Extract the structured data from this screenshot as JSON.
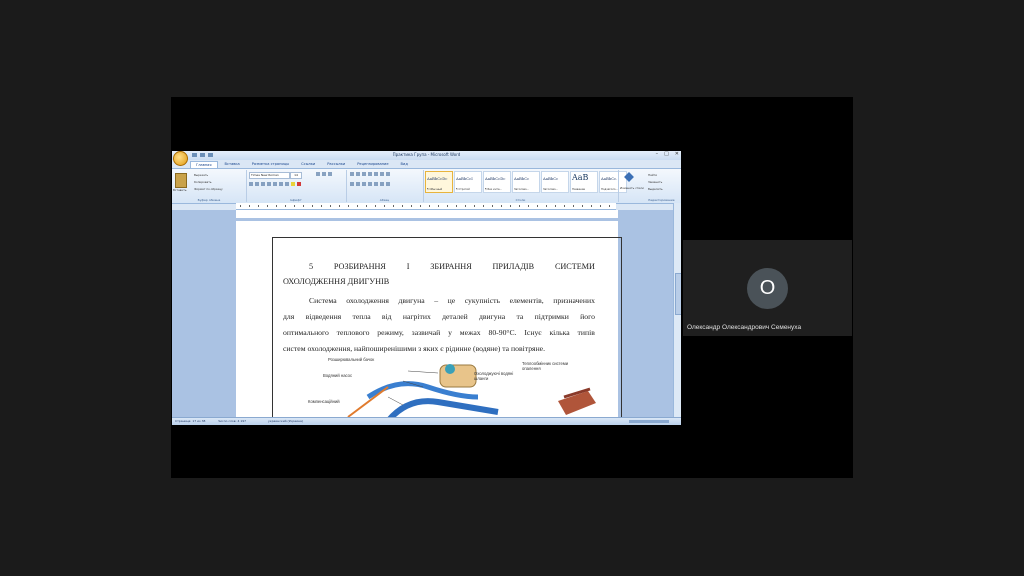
{
  "word": {
    "title": "Практика Група - Microsoft Word",
    "tabs": [
      "Главная",
      "Вставка",
      "Разметка страницы",
      "Ссылки",
      "Рассылки",
      "Рецензирование",
      "Вид"
    ],
    "clipboard": {
      "paste": "Вставить",
      "cut": "Вырезать",
      "copy": "Копировать",
      "format_painter": "Формат по образцу",
      "group": "Буфер обмена"
    },
    "font": {
      "name": "Times New Roman",
      "size": "14",
      "group": "Шрифт"
    },
    "paragraph_group": "Абзац",
    "styles_group": "Стили",
    "editing_group": "Редактирование",
    "styles": [
      {
        "preview": "AaBbCcDc",
        "label": "¶ Обычный"
      },
      {
        "preview": "AaBbCcI",
        "label": "¶ Строгий"
      },
      {
        "preview": "AaBbCcDc",
        "label": "¶ Без инте..."
      },
      {
        "preview": "AaBbCc",
        "label": "Заголово..."
      },
      {
        "preview": "AaBbCc",
        "label": "Заголово..."
      },
      {
        "preview": "AaB",
        "label": "Название"
      },
      {
        "preview": "AaBbCc.",
        "label": "Подзаголо..."
      }
    ],
    "change_styles": "Изменить стили",
    "editing": {
      "find": "Найти",
      "replace": "Заменить",
      "select": "Выделить"
    },
    "document": {
      "heading_line1": [
        "5",
        "РОЗБИРАННЯ",
        "І",
        "ЗБИРАННЯ",
        "ПРИЛАДІВ",
        "СИСТЕМИ"
      ],
      "heading_line2": "ОХОЛОДЖЕННЯ ДВИГУНІВ",
      "para_line1": [
        "Система",
        "охолодження",
        "двигуна",
        "–",
        "це",
        "сукупність",
        "елементів,",
        "призначених"
      ],
      "para_line2": [
        "для",
        "відведення",
        "тепла",
        "від",
        "нагрітих",
        "деталей",
        "двигуна",
        "та",
        "підтримки",
        "його"
      ],
      "para_line3": [
        "оптимального",
        "теплового",
        "режиму,",
        "зазвичай",
        "у",
        "межах",
        "80-90°С.",
        "Існує",
        "кілька",
        "типів"
      ],
      "para_line4": "систем охолодження, найпоширенішими з яких є рідинне (водяне) та повітряне.",
      "figure_labels": {
        "tank": "Розширювальний бачок",
        "pump": "Водяний насос",
        "hoses": "Охолоджуючі водяні шланги",
        "heater": "Теплообмінник системи опалення",
        "compensator": "Компенсаційний"
      }
    },
    "status": {
      "page": "Страница: 17 из 38",
      "words": "Число слов: 4 197",
      "lang": "украинский (Украина)"
    }
  },
  "participant": {
    "initial": "О",
    "name": "Олександр Олександрович Семенуха"
  }
}
